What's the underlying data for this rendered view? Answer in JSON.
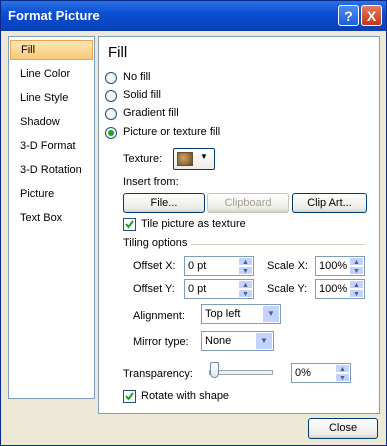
{
  "window": {
    "title": "Format Picture",
    "help_glyph": "?",
    "close_glyph": "X"
  },
  "nav": {
    "items": [
      "Fill",
      "Line Color",
      "Line Style",
      "Shadow",
      "3-D Format",
      "3-D Rotation",
      "Picture",
      "Text Box"
    ],
    "selected": "Fill"
  },
  "fill": {
    "heading": "Fill",
    "options": [
      "No fill",
      "Solid fill",
      "Gradient fill",
      "Picture or texture fill"
    ],
    "selected_option": "Picture or texture fill",
    "texture_label": "Texture:",
    "insert_from_label": "Insert from:",
    "file_button": "File...",
    "clipboard_button": "Clipboard",
    "clipart_button": "Clip Art...",
    "tile_checkbox": {
      "label": "Tile picture as texture",
      "checked": true
    },
    "tiling_options_label": "Tiling options",
    "offset_x": {
      "label": "Offset X:",
      "value": "0 pt"
    },
    "offset_y": {
      "label": "Offset Y:",
      "value": "0 pt"
    },
    "scale_x": {
      "label": "Scale X:",
      "value": "100%"
    },
    "scale_y": {
      "label": "Scale Y:",
      "value": "100%"
    },
    "alignment": {
      "label": "Alignment:",
      "value": "Top left"
    },
    "mirror_type": {
      "label": "Mirror type:",
      "value": "None"
    },
    "transparency": {
      "label": "Transparency:",
      "value": "0%",
      "level": 0
    },
    "rotate_checkbox": {
      "label": "Rotate with shape",
      "checked": true
    }
  },
  "footer": {
    "close_button": "Close"
  },
  "icons": [
    "help-icon",
    "close-icon",
    "texture-swatch-icon",
    "chevron-down-icon",
    "spin-up-icon",
    "spin-down-icon",
    "checkmark-icon"
  ],
  "colors": {
    "title_bar": "#0a4fd1",
    "nav_selected": "#f9c87a",
    "radio_dot": "#21a121",
    "checkmark": "#21a121"
  }
}
